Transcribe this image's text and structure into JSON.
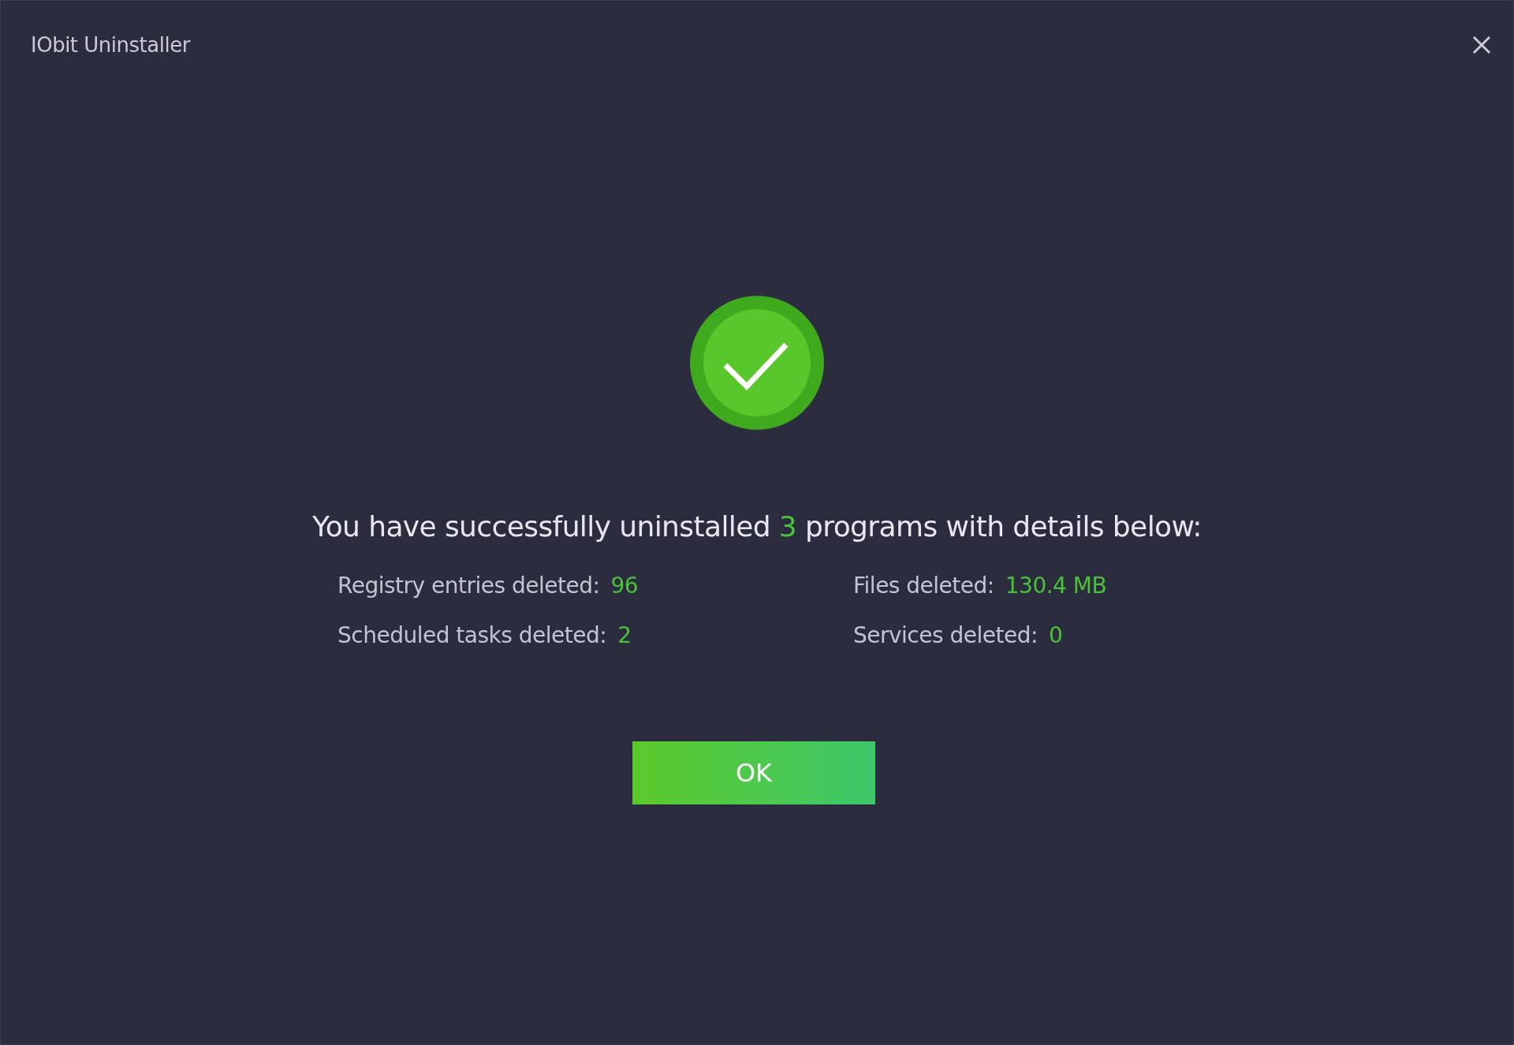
{
  "window": {
    "title": "IObit Uninstaller"
  },
  "message": {
    "before": "You have successfully uninstalled",
    "count": "3",
    "after": "programs with details below:"
  },
  "stats": [
    {
      "label": "Registry entries deleted:",
      "value": "96"
    },
    {
      "label": "Files deleted:",
      "value": "130.4 MB"
    },
    {
      "label": "Scheduled tasks deleted:",
      "value": "2"
    },
    {
      "label": "Services deleted:",
      "value": "0"
    }
  ],
  "button": {
    "label": "OK"
  }
}
